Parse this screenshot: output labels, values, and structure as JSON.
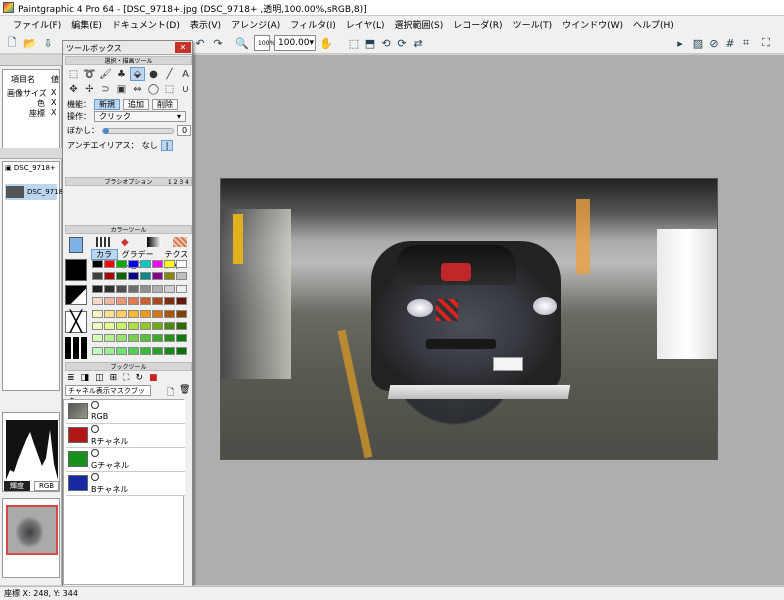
{
  "window": {
    "title": "Paintgraphic 4 Pro 64 - [DSC_9718+.jpg (DSC_9718+ ,透明,100.00%,sRGB,8)]"
  },
  "menu": [
    "ファイル(F)",
    "編集(E)",
    "ドキュメント(D)",
    "表示(V)",
    "アレンジ(A)",
    "フィルタ(I)",
    "レイヤ(L)",
    "選択範囲(S)",
    "レコーダ(R)",
    "ツール(T)",
    "ウインドウ(W)",
    "ヘルプ(H)"
  ],
  "toolbar": {
    "zoom_value": "100.00",
    "zoom_small": "100%"
  },
  "toolbox": {
    "title": "ツールボックス",
    "close": "✕",
    "section_select": "選択・描画ツール",
    "mode_label": "機能：",
    "mode_options": [
      "新規",
      "追加",
      "削除"
    ],
    "mode_selected": "新規",
    "operation_label": "操作：",
    "operation_value": "クリック",
    "blur_label": "ぼかし：",
    "blur_value": "0",
    "antialias_label": "アンチエイリアス：",
    "antialias_none": "なし",
    "antialias_on": "|",
    "section_brush": "ブラシオプション",
    "brush_tabs": [
      "1",
      "2",
      "3",
      "4"
    ],
    "section_color": "カラーツール",
    "color_tabs": [
      "カラー",
      "グラデーション",
      "テクスチャ"
    ],
    "section_book": "ブックツール",
    "channel_mode": "チャネル表示マスクブック",
    "channels": [
      {
        "label": "RGB",
        "thumb": "#777066"
      },
      {
        "label": "Rチャネル",
        "thumb": "#b01818"
      },
      {
        "label": "Gチャネル",
        "thumb": "#18901c"
      },
      {
        "label": "Bチャネル",
        "thumb": "#1828a0"
      }
    ]
  },
  "left_panel": {
    "prop_headers": [
      "項目名",
      "値"
    ],
    "props": [
      {
        "name": "画像サイズ",
        "value": "X"
      },
      {
        "name": "色",
        "value": "X"
      },
      {
        "name": "座標",
        "value": "X"
      }
    ],
    "file_name": "DSC_9718+",
    "layer_name": "DSC_9718",
    "hist_labels": [
      "輝度",
      "RGB"
    ]
  },
  "status": {
    "text": "座標 X: 248, Y: 344"
  },
  "colors": {
    "accent": "#bdd6f0",
    "close": "#c7322b",
    "canvas_bg": "#aeaeae"
  }
}
